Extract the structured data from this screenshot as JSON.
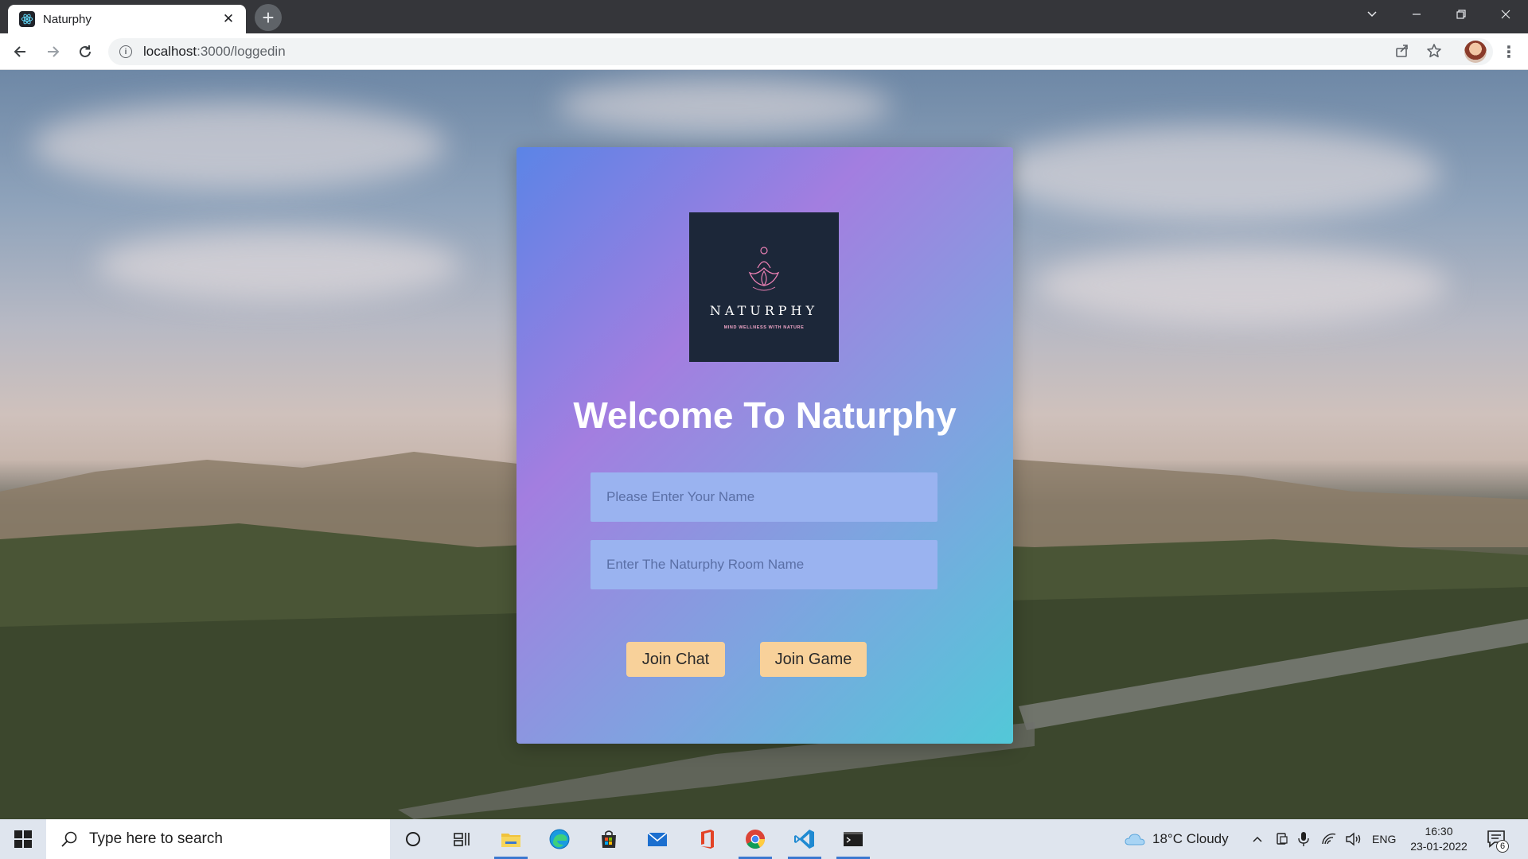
{
  "browser": {
    "tab": {
      "title": "Naturphy",
      "close_glyph": "✕"
    },
    "new_tab_glyph": "+",
    "url": {
      "host": "localhost",
      "path": ":3000/loggedin"
    },
    "window_controls": [
      "chevron-down-icon",
      "minimize-icon",
      "restore-icon",
      "close-icon"
    ]
  },
  "page": {
    "logo": {
      "name": "NATURPHY",
      "tagline": "MIND WELLNESS WITH NATURE"
    },
    "welcome": "Welcome To Naturphy",
    "name_input": {
      "placeholder": "Please Enter Your Name",
      "value": ""
    },
    "room_input": {
      "placeholder": "Enter The Naturphy Room Name",
      "value": ""
    },
    "buttons": {
      "join_chat": "Join Chat",
      "join_game": "Join Game"
    },
    "colors": {
      "card_gradient": [
        "#5b84e6",
        "#a37ee0",
        "#52c8d8"
      ],
      "button": "#f8d19a",
      "field": "#9ab3f0"
    }
  },
  "taskbar": {
    "search_placeholder": "Type here to search",
    "weather": "18°C  Cloudy",
    "language": "ENG",
    "time": "16:30",
    "date": "23-01-2022",
    "notification_count": "6",
    "pinned_apps": [
      "cortana-icon",
      "task-view-icon",
      "file-explorer-icon",
      "edge-icon",
      "store-icon",
      "mail-icon",
      "office-icon",
      "chrome-icon",
      "vscode-icon",
      "terminal-icon"
    ]
  }
}
